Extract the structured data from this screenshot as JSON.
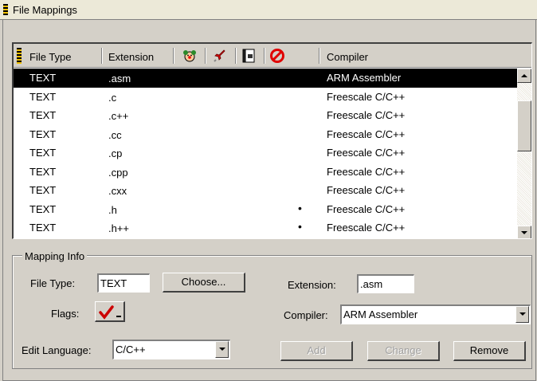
{
  "window": {
    "title": "File Mappings"
  },
  "table": {
    "columns": {
      "file_type": "File Type",
      "extension": "Extension",
      "compiler": "Compiler"
    },
    "header_icons": [
      "clown-face-icon",
      "rocket-icon",
      "document-icon",
      "prohibited-icon"
    ],
    "rows": [
      {
        "file_type": "TEXT",
        "extension": ".asm",
        "flag": "",
        "compiler": "ARM Assembler",
        "selected": true
      },
      {
        "file_type": "TEXT",
        "extension": ".c",
        "flag": "",
        "compiler": "Freescale C/C++"
      },
      {
        "file_type": "TEXT",
        "extension": ".c++",
        "flag": "",
        "compiler": "Freescale C/C++"
      },
      {
        "file_type": "TEXT",
        "extension": ".cc",
        "flag": "",
        "compiler": "Freescale C/C++"
      },
      {
        "file_type": "TEXT",
        "extension": ".cp",
        "flag": "",
        "compiler": "Freescale C/C++"
      },
      {
        "file_type": "TEXT",
        "extension": ".cpp",
        "flag": "",
        "compiler": "Freescale C/C++"
      },
      {
        "file_type": "TEXT",
        "extension": ".cxx",
        "flag": "",
        "compiler": "Freescale C/C++"
      },
      {
        "file_type": "TEXT",
        "extension": ".h",
        "flag": "•",
        "compiler": "Freescale C/C++"
      },
      {
        "file_type": "TEXT",
        "extension": ".h++",
        "flag": "•",
        "compiler": "Freescale C/C++"
      }
    ]
  },
  "mapping_info": {
    "legend": "Mapping Info",
    "file_type_label": "File Type:",
    "file_type_value": "TEXT",
    "choose_label": "Choose...",
    "extension_label": "Extension:",
    "extension_value": ".asm",
    "flags_label": "Flags:",
    "compiler_label": "Compiler:",
    "compiler_value": "ARM Assembler",
    "edit_language_label": "Edit Language:",
    "edit_language_value": "C/C++",
    "add_label": "Add",
    "change_label": "Change",
    "remove_label": "Remove"
  },
  "colors": {
    "selection_bg": "#000000",
    "selection_fg": "#ffffff",
    "flag_check": "#cc0000",
    "prohibited": "#e00000"
  }
}
